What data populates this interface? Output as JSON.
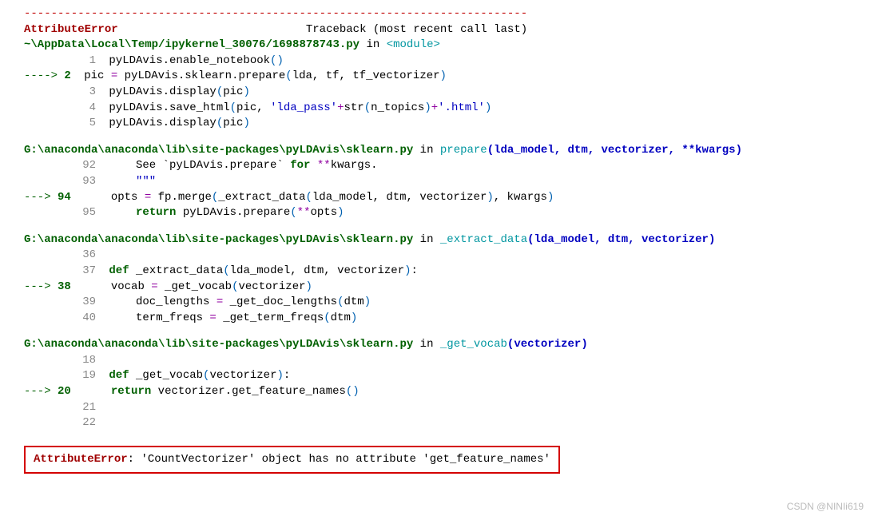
{
  "separator": "---------------------------------------------------------------------------",
  "error_name": "AttributeError",
  "header_rhs": "Traceback (most recent call last)",
  "frame1": {
    "path": "~\\AppData\\Local\\Temp/ipykernel_30076/1698878743.py",
    "in_kw": " in ",
    "module_tag": "<module>",
    "lines": {
      "n1": "1",
      "c1a": " pyLDAvis.enable_notebook",
      "c1b": "()",
      "n2_arrow": "----> ",
      "n2": "2",
      "c2a": " pic ",
      "c2b": "=",
      "c2c": " pyLDAvis.sklearn.prepare",
      "c2d": "(",
      "c2e": "lda, tf, tf_vectorizer",
      "c2f": ")",
      "n3": "3",
      "c3a": " pyLDAvis.display",
      "c3b": "(",
      "c3c": "pic",
      "c3d": ")",
      "n4": "4",
      "c4a": " pyLDAvis.save_html",
      "c4b": "(",
      "c4c": "pic, ",
      "c4d": "'lda_pass'",
      "c4e": "+",
      "c4f": "str",
      "c4g": "(",
      "c4h": "n_topics",
      "c4i": ")",
      "c4j": "+",
      "c4k": "'.html'",
      "c4l": ")",
      "n5": "5",
      "c5a": " pyLDAvis.display",
      "c5b": "(",
      "c5c": "pic",
      "c5d": ")"
    }
  },
  "frame2": {
    "path": "G:\\anaconda\\anaconda\\lib\\site-packages\\pyLDAvis\\sklearn.py",
    "in_kw": " in ",
    "func": "prepare",
    "sig_open": "(",
    "sig_args": "lda_model, dtm, vectorizer, **kwargs",
    "sig_close": ")",
    "lines": {
      "n92": "92",
      "c92a": "     See `pyLDAvis.prepare` ",
      "c92b": "for",
      "c92c": " ",
      "c92d": "**",
      "c92e": "kwargs.",
      "n93": "93",
      "c93": "     \"\"\"",
      "n94_arrow": "---> ",
      "n94": "94",
      "c94a": "     opts ",
      "c94b": "=",
      "c94c": " fp.merge",
      "c94d": "(",
      "c94e": "_extract_data",
      "c94f": "(",
      "c94g": "lda_model, dtm, vectorizer",
      "c94h": ")",
      "c94i": ", kwargs",
      "c94j": ")",
      "n95": "95",
      "c95a": "     ",
      "c95b": "return",
      "c95c": " pyLDAvis.prepare",
      "c95d": "(",
      "c95e": "**",
      "c95f": "opts",
      "c95g": ")"
    }
  },
  "frame3": {
    "path": "G:\\anaconda\\anaconda\\lib\\site-packages\\pyLDAvis\\sklearn.py",
    "in_kw": " in ",
    "func": "_extract_data",
    "sig_open": "(",
    "sig_args": "lda_model, dtm, vectorizer",
    "sig_close": ")",
    "lines": {
      "n36": "36",
      "n37": "37",
      "c37a": " ",
      "c37b": "def",
      "c37c": " _extract_data",
      "c37d": "(",
      "c37e": "lda_model, dtm, vectorizer",
      "c37f": ")",
      "c37g": ":",
      "n38_arrow": "---> ",
      "n38": "38",
      "c38a": "     vocab ",
      "c38b": "=",
      "c38c": " _get_vocab",
      "c38d": "(",
      "c38e": "vectorizer",
      "c38f": ")",
      "n39": "39",
      "c39a": "     doc_lengths ",
      "c39b": "=",
      "c39c": " _get_doc_lengths",
      "c39d": "(",
      "c39e": "dtm",
      "c39f": ")",
      "n40": "40",
      "c40a": "     term_freqs ",
      "c40b": "=",
      "c40c": " _get_term_freqs",
      "c40d": "(",
      "c40e": "dtm",
      "c40f": ")"
    }
  },
  "frame4": {
    "path": "G:\\anaconda\\anaconda\\lib\\site-packages\\pyLDAvis\\sklearn.py",
    "in_kw": " in ",
    "func": "_get_vocab",
    "sig_open": "(",
    "sig_args": "vectorizer",
    "sig_close": ")",
    "lines": {
      "n18": "18",
      "n19": "19",
      "c19a": " ",
      "c19b": "def",
      "c19c": " _get_vocab",
      "c19d": "(",
      "c19e": "vectorizer",
      "c19f": ")",
      "c19g": ":",
      "n20_arrow": "---> ",
      "n20": "20",
      "c20a": "     ",
      "c20b": "return",
      "c20c": " vectorizer.get_feature_names",
      "c20d": "()",
      "n21": "21",
      "n22": "22"
    }
  },
  "final": {
    "name": "AttributeError",
    "sep": ": ",
    "msg": "'CountVectorizer' object has no attribute 'get_feature_names'"
  },
  "watermark": "CSDN @NINIi619"
}
